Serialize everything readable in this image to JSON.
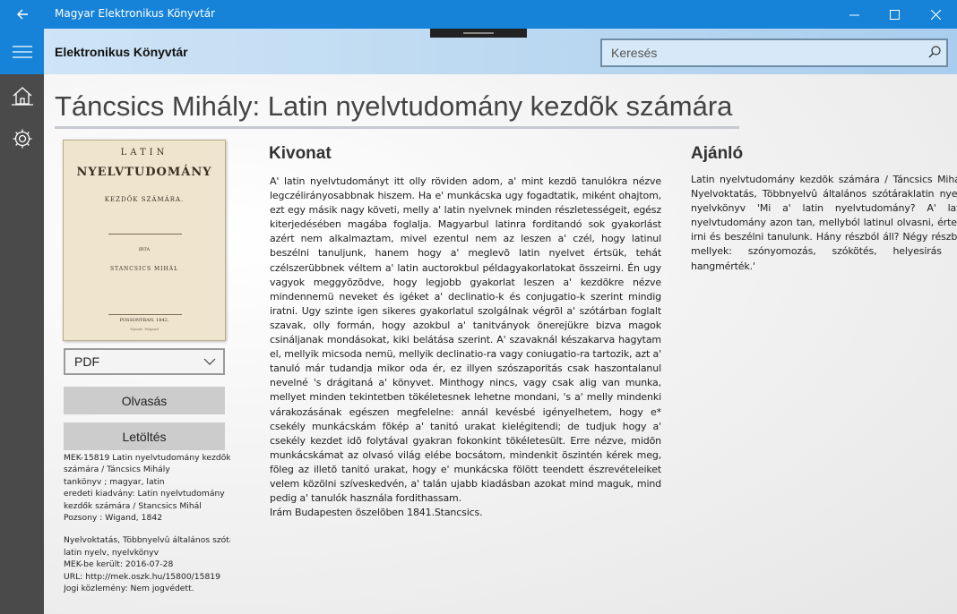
{
  "window": {
    "title": "Magyar Elektronikus Könyvtár"
  },
  "header": {
    "title": "Elektronikus Könyvtár",
    "search_placeholder": "Keresés"
  },
  "book": {
    "title": "Táncsics Mihály: Latin nyelvtudomány kezdõk számára",
    "cover": {
      "line1": "LATIN",
      "line2": "NYELVTUDOMÁNY",
      "line3": "KEZDŐK SZÁMÁRA.",
      "line4": "IRTA",
      "line5": "STANCSICS MIHÁL",
      "line6": "POSSONYBAN. 1842.",
      "line7": "Nyomt. Wigand"
    },
    "format": "PDF",
    "read_label": "Olvasás",
    "download_label": "Letöltés",
    "meta_block1": [
      "MEK-15819 Latin nyelvtudomány kezdõk",
      "számára / Táncsics Mihály",
      "tankönyv ;  magyar, latin",
      "eredeti kiadvány: Latin nyelvtudomány",
      "kezdők számára / Stancsics Mihál",
      "Pozsony : Wigand, 1842"
    ],
    "meta_block2": [
      "Nyelvoktatás, Többnyelvû általános szótáral",
      "latin nyelv, nyelvkönyv",
      "MEK-be került: 2016-07-28",
      "URL: http://mek.oszk.hu/15800/15819",
      "Jogi közlemény: Nem jogvédett."
    ]
  },
  "kivonat": {
    "heading": "Kivonat",
    "paragraph1": "A' latin nyelvtudományt itt olly röviden adom, a' mint kezdõ tanulókra nézve legczélirányosabbnak hiszem. Ha e' munkácska ugy fogadtatik, miként ohajtom, ezt egy másik nagy követi, melly a' latin nyelvnek minden részletességeit, egész kiterjedésében magába foglalja. Magyarbul latinra forditandó sok gyakorlást azért nem alkalmaztam, mivel ezentul nem az leszen a' czél, hogy latinul beszélni tanuljunk, hanem hogy a' meglevõ latin nyelvet értsük, tehát czélszerübbnek véltem a' latin auctorokbul példagyakorlatokat összeirni. Én ugy vagyok meggyõzõdve, hogy legjobb gyakorlat leszen a' kezdõkre nézve mindennemü neveket és igéket a' declinatio-k és conjugatio-k szerint mindig iratni. Ugy szinte igen sikeres gyakorlatul szolgálnak végrõl a' szótárban foglalt szavak, olly formán, hogy azokbul a' tanitványok önerejükre bizva magok csináljanak mondásokat, kiki belátása szerint. A' szavaknál készakarva hagytam el, mellyik micsoda nemü, mellyik declinatio-ra vagy coniugatio-ra tartozik, azt a' tanuló már tudandja mikor oda ér, ez illyen szószaporitás csak haszontalanul nevelné 's drágitaná a' könyvet. Minthogy nincs, vagy csak alig van munka, mellyet minden tekintetben tökéletesnek lehetne mondani, 's a' melly mindenki várakozásának egészen megfelelne: annál kevésbé igényelhetem, hogy e* csekély munkácskám fõkép a' tanitó urakat kielégitendi; de tudjuk hogy a' csekély kezdet idõ folytával gyakran fokonkint tökéletesült. Erre nézve, midõn munkácskámat az olvasó világ elébe bocsátom, mindenkit õszintén kérek meg, fõleg az illetõ tanitó urakat, hogy e' munkácska fölött teendett észrevételeiket velem közölni szíveskedvén, a' talán ujabb kiadásban azokat mind maguk, mind pedig a' tanulók használa fordithassam.",
    "paragraph2": "Irám Budapesten õszelõben 1841.Stancsics."
  },
  "ajanlo": {
    "heading": "Ajánló",
    "text": "Latin nyelvtudomány kezdõk számára / Táncsics Mihály Nyelvoktatás, Többnyelvû általános szótáraklatin nyelv, nyelvkönyv 'Mi a' latin nyelvtudomány? A' latin nyelvtudomány azon tan, mellyból latinul olvasni, érteni, irni és beszélni tanulunk. Hány részból áll? Négy részból, mellyek: szónyomozás, szókötés, helyesirás és hangmérték.'"
  }
}
